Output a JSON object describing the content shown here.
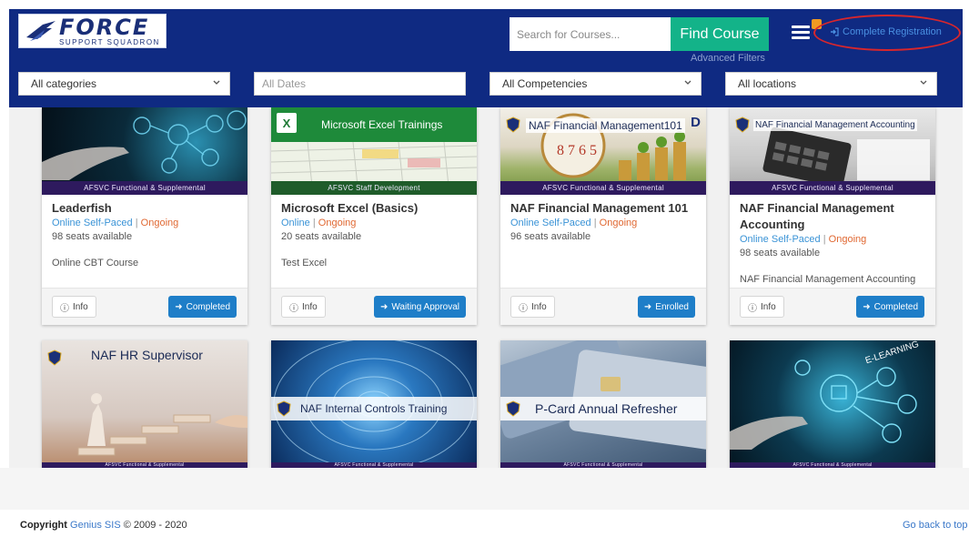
{
  "header": {
    "logo_main": "FORCE",
    "logo_sub": "SUPPORT SQUADRON",
    "search_placeholder": "Search for Courses...",
    "find_button": "Find Course",
    "advanced_filters": "Advanced Filters",
    "complete_registration": "Complete Registration"
  },
  "filters": {
    "categories": "All categories",
    "dates_placeholder": "All Dates",
    "competencies": "All Competencies",
    "locations": "All locations"
  },
  "cards_row1": [
    {
      "banner": "AFSVC Functional & Supplemental",
      "title": "Leaderfish",
      "mode": "Online Self-Paced",
      "status": "Ongoing",
      "seats": "98 seats available",
      "desc": "Online CBT Course",
      "info": "Info",
      "action": "Completed"
    },
    {
      "img_title": "Microsoft Excel Trainings",
      "banner": "AFSVC Staff Development",
      "title": "Microsoft Excel (Basics)",
      "mode": "Online",
      "status": "Ongoing",
      "seats": "20 seats available",
      "desc": "Test Excel",
      "info": "Info",
      "action": "Waiting Approval"
    },
    {
      "img_title": "NAF Financial Management101",
      "banner": "AFSVC Functional & Supplemental",
      "title": "NAF Financial Management 101",
      "mode": "Online Self-Paced",
      "status": "Ongoing",
      "seats": "96 seats available",
      "desc": "",
      "info": "Info",
      "action": "Enrolled"
    },
    {
      "img_title": "NAF Financial Management Accounting",
      "banner": "AFSVC Functional & Supplemental",
      "title": "NAF Financial Management Accounting",
      "mode": "Online Self-Paced",
      "status": "Ongoing",
      "seats": "98 seats available",
      "desc": "NAF Financial Management Accounting",
      "info": "Info",
      "action": "Completed"
    }
  ],
  "cards_row2": [
    {
      "img_title": "NAF HR Supervisor",
      "banner": "AFSVC Functional & Supplemental"
    },
    {
      "img_title": "NAF Internal Controls Training",
      "banner": "AFSVC Functional & Supplemental"
    },
    {
      "img_title": "P-Card Annual Refresher",
      "banner": "AFSVC Functional & Supplemental"
    },
    {
      "img_title": "E-LEARNING",
      "banner": "AFSVC Functional & Supplemental"
    }
  ],
  "footer": {
    "copyright_label": "Copyright",
    "company": "Genius SIS",
    "years": "© 2009 - 2020",
    "back_to_top": "Go back to top"
  },
  "colors": {
    "header_bg": "#0f2a82",
    "find_button": "#13b389",
    "action_button": "#1e7ec8",
    "status_orange": "#e06832",
    "mode_blue": "#3a93d6",
    "highlight_oval": "#d8262c"
  }
}
